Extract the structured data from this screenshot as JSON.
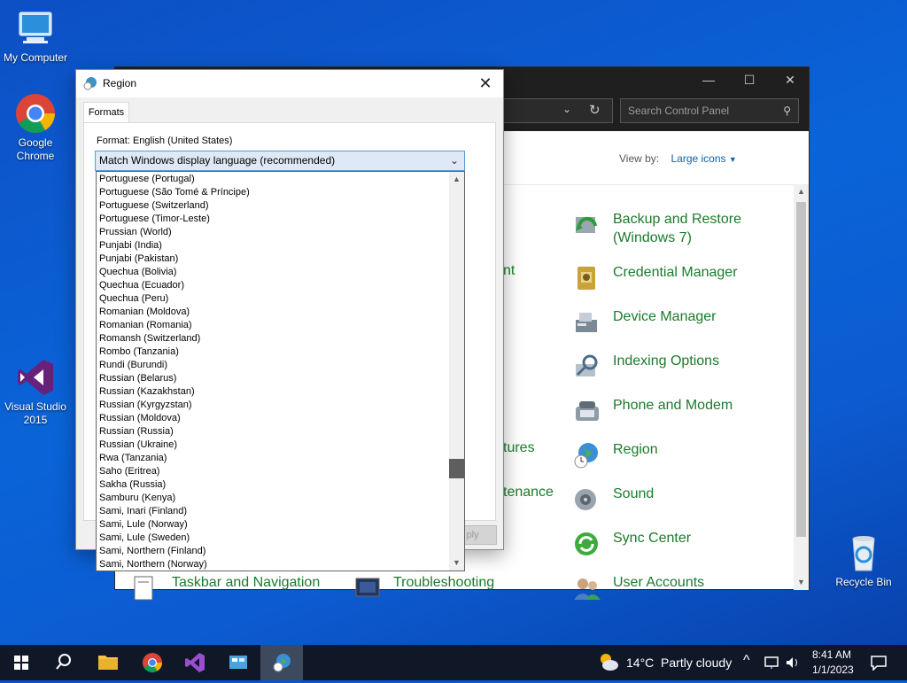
{
  "desktop": {
    "icons": [
      {
        "label": "My Computer",
        "icon": "my-computer-icon"
      },
      {
        "label": "Google Chrome",
        "icon": "chrome-icon"
      },
      {
        "label": "Visual Studio 2015",
        "icon": "visual-studio-icon"
      },
      {
        "label": "Recycle Bin",
        "icon": "recycle-bin-icon"
      }
    ]
  },
  "control_panel": {
    "search_placeholder": "Search Control Panel",
    "view_by_label": "View by:",
    "view_by_value": "Large icons",
    "partial_items": [
      "nt",
      "tures",
      "tenance"
    ],
    "items": [
      {
        "label": "Backup and Restore (Windows 7)",
        "icon": "backup-restore-icon"
      },
      {
        "label": "Credential Manager",
        "icon": "credential-manager-icon"
      },
      {
        "label": "Device Manager",
        "icon": "device-manager-icon"
      },
      {
        "label": "Indexing Options",
        "icon": "indexing-options-icon"
      },
      {
        "label": "Phone and Modem",
        "icon": "phone-modem-icon"
      },
      {
        "label": "Region",
        "icon": "region-icon"
      },
      {
        "label": "Sound",
        "icon": "sound-icon"
      },
      {
        "label": "Sync Center",
        "icon": "sync-center-icon"
      },
      {
        "label": "User Accounts",
        "icon": "user-accounts-icon"
      }
    ],
    "bottom_items": [
      {
        "label": "Taskbar and Navigation",
        "icon": "taskbar-navigation-icon"
      },
      {
        "label": "Troubleshooting",
        "icon": "troubleshooting-icon"
      }
    ]
  },
  "region_dialog": {
    "title": "Region",
    "close": "✕",
    "tab": "Formats",
    "format_label": "Format: English (United States)",
    "selected": "Match Windows display language (recommended)",
    "apply_label": "ply",
    "options": [
      "Portuguese (Portugal)",
      "Portuguese (São Tomé & Príncipe)",
      "Portuguese (Switzerland)",
      "Portuguese (Timor-Leste)",
      "Prussian (World)",
      "Punjabi (India)",
      "Punjabi (Pakistan)",
      "Quechua (Bolivia)",
      "Quechua (Ecuador)",
      "Quechua (Peru)",
      "Romanian (Moldova)",
      "Romanian (Romania)",
      "Romansh (Switzerland)",
      "Rombo (Tanzania)",
      "Rundi (Burundi)",
      "Russian (Belarus)",
      "Russian (Kazakhstan)",
      "Russian (Kyrgyzstan)",
      "Russian (Moldova)",
      "Russian (Russia)",
      "Russian (Ukraine)",
      "Rwa (Tanzania)",
      "Saho (Eritrea)",
      "Sakha (Russia)",
      "Samburu (Kenya)",
      "Sami, Inari (Finland)",
      "Sami, Lule (Norway)",
      "Sami, Lule (Sweden)",
      "Sami, Northern (Finland)",
      "Sami, Northern (Norway)"
    ]
  },
  "taskbar": {
    "weather": "14°C  Partly cloudy",
    "time": "8:41 AM",
    "date": "1/1/2023"
  },
  "colors": {
    "accent_green": "#1c7a2c",
    "link_blue": "#0b5fb5",
    "taskbar": "#101828"
  }
}
